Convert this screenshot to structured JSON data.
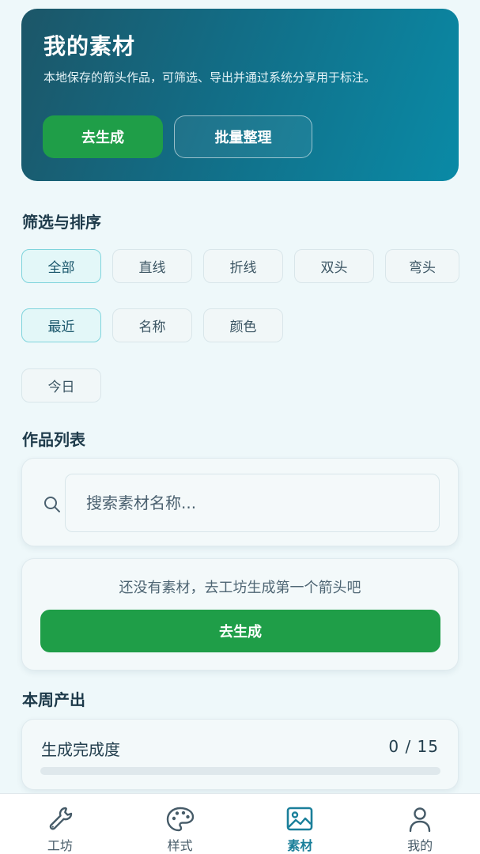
{
  "hero": {
    "title": "我的素材",
    "description": "本地保存的箭头作品，可筛选、导出并通过系统分享用于标注。",
    "primary_button": "去生成",
    "secondary_button": "批量整理"
  },
  "filter_section": {
    "title": "筛选与排序",
    "type_chips": [
      {
        "label": "全部",
        "active": true
      },
      {
        "label": "直线",
        "active": false
      },
      {
        "label": "折线",
        "active": false
      },
      {
        "label": "双头",
        "active": false
      },
      {
        "label": "弯头",
        "active": false
      }
    ],
    "sort_chips": [
      {
        "label": "最近",
        "active": true
      },
      {
        "label": "名称",
        "active": false
      },
      {
        "label": "颜色",
        "active": false
      }
    ],
    "date_chips": [
      {
        "label": "今日",
        "active": false
      }
    ]
  },
  "list_section": {
    "title": "作品列表",
    "search_placeholder": "搜索素材名称...",
    "empty_text": "还没有素材，去工坊生成第一个箭头吧",
    "generate_button": "去生成"
  },
  "weekly_section": {
    "title": "本周产出",
    "progress_label": "生成完成度",
    "progress_text": "0 / 15",
    "progress_fraction": 0
  },
  "bottom_nav": [
    {
      "label": "工坊",
      "icon": "wrench-icon",
      "active": false
    },
    {
      "label": "样式",
      "icon": "palette-icon",
      "active": false
    },
    {
      "label": "素材",
      "icon": "image-icon",
      "active": true
    },
    {
      "label": "我的",
      "icon": "user-icon",
      "active": false
    }
  ],
  "colors": {
    "accent_green": "#1f9e48",
    "active_nav": "#1a7f9a"
  }
}
